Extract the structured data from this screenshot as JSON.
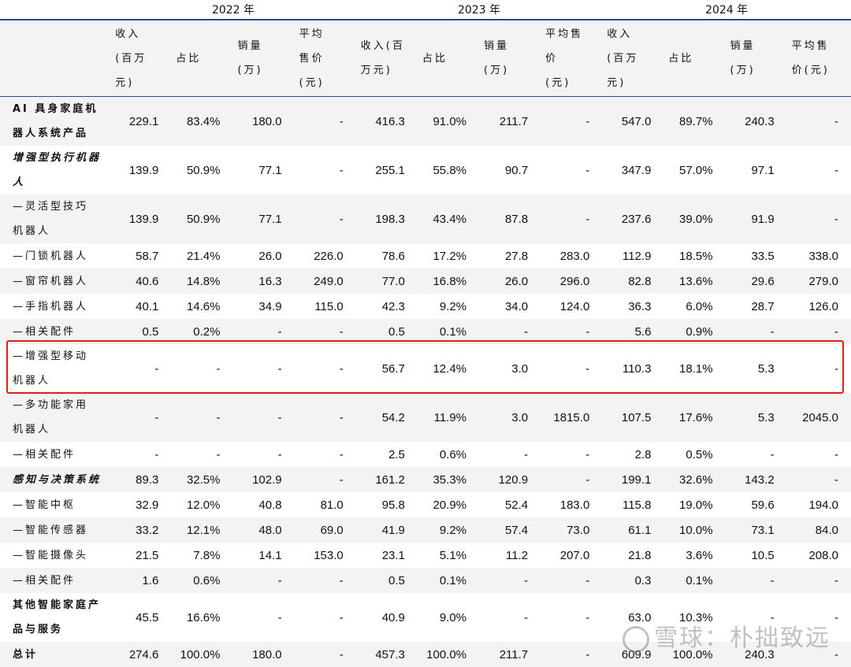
{
  "years": [
    "2022 年",
    "2023 年",
    "2024 年"
  ],
  "headers": {
    "h2022": [
      "收入\n(百万\n元)",
      "占比",
      "销量\n(万)",
      "平均\n售价\n(元)"
    ],
    "h2023": [
      "收入(百\n万元)",
      "占比",
      "销量\n(万)",
      "平均售\n价\n(元)"
    ],
    "h2024": [
      "收入\n(百万\n元)",
      "占比",
      "销量\n(万)",
      "平均售\n价(元)"
    ]
  },
  "rows": [
    {
      "label": "AI 具身家庭机\n器人系统产品",
      "style": "bold",
      "v": [
        "229.1",
        "83.4%",
        "180.0",
        "-",
        "416.3",
        "91.0%",
        "211.7",
        "-",
        "547.0",
        "89.7%",
        "240.3",
        "-"
      ]
    },
    {
      "label": "增强型执行机器\n人",
      "style": "bold-italic",
      "v": [
        "139.9",
        "50.9%",
        "77.1",
        "-",
        "255.1",
        "55.8%",
        "90.7",
        "-",
        "347.9",
        "57.0%",
        "97.1",
        "-"
      ]
    },
    {
      "label": "—灵活型技巧\n机器人",
      "style": "",
      "v": [
        "139.9",
        "50.9%",
        "77.1",
        "-",
        "198.3",
        "43.4%",
        "87.8",
        "-",
        "237.6",
        "39.0%",
        "91.9",
        "-"
      ]
    },
    {
      "label": "—门锁机器人",
      "style": "",
      "v": [
        "58.7",
        "21.4%",
        "26.0",
        "226.0",
        "78.6",
        "17.2%",
        "27.8",
        "283.0",
        "112.9",
        "18.5%",
        "33.5",
        "338.0"
      ]
    },
    {
      "label": "—窗帘机器人",
      "style": "",
      "v": [
        "40.6",
        "14.8%",
        "16.3",
        "249.0",
        "77.0",
        "16.8%",
        "26.0",
        "296.0",
        "82.8",
        "13.6%",
        "29.6",
        "279.0"
      ]
    },
    {
      "label": "—手指机器人",
      "style": "",
      "v": [
        "40.1",
        "14.6%",
        "34.9",
        "115.0",
        "42.3",
        "9.2%",
        "34.0",
        "124.0",
        "36.3",
        "6.0%",
        "28.7",
        "126.0"
      ]
    },
    {
      "label": "—相关配件",
      "style": "",
      "v": [
        "0.5",
        "0.2%",
        "-",
        "-",
        "0.5",
        "0.1%",
        "-",
        "-",
        "5.6",
        "0.9%",
        "-",
        "-"
      ]
    },
    {
      "label": "—增强型移动\n机器人",
      "style": "",
      "v": [
        "-",
        "-",
        "-",
        "-",
        "56.7",
        "12.4%",
        "3.0",
        "-",
        "110.3",
        "18.1%",
        "5.3",
        "-"
      ]
    },
    {
      "label": "—多功能家用\n机器人",
      "style": "",
      "v": [
        "-",
        "-",
        "-",
        "-",
        "54.2",
        "11.9%",
        "3.0",
        "1815.0",
        "107.5",
        "17.6%",
        "5.3",
        "2045.0"
      ]
    },
    {
      "label": "—相关配件",
      "style": "",
      "v": [
        "-",
        "-",
        "-",
        "-",
        "2.5",
        "0.6%",
        "-",
        "-",
        "2.8",
        "0.5%",
        "-",
        "-"
      ]
    },
    {
      "label": "感知与决策系统",
      "style": "bold-italic",
      "v": [
        "89.3",
        "32.5%",
        "102.9",
        "-",
        "161.2",
        "35.3%",
        "120.9",
        "-",
        "199.1",
        "32.6%",
        "143.2",
        "-"
      ]
    },
    {
      "label": "—智能中枢",
      "style": "",
      "v": [
        "32.9",
        "12.0%",
        "40.8",
        "81.0",
        "95.8",
        "20.9%",
        "52.4",
        "183.0",
        "115.8",
        "19.0%",
        "59.6",
        "194.0"
      ]
    },
    {
      "label": "—智能传感器",
      "style": "",
      "v": [
        "33.2",
        "12.1%",
        "48.0",
        "69.0",
        "41.9",
        "9.2%",
        "57.4",
        "73.0",
        "61.1",
        "10.0%",
        "73.1",
        "84.0"
      ]
    },
    {
      "label": "—智能摄像头",
      "style": "",
      "v": [
        "21.5",
        "7.8%",
        "14.1",
        "153.0",
        "23.1",
        "5.1%",
        "11.2",
        "207.0",
        "21.8",
        "3.6%",
        "10.5",
        "208.0"
      ]
    },
    {
      "label": "—相关配件",
      "style": "",
      "v": [
        "1.6",
        "0.6%",
        "-",
        "-",
        "0.5",
        "0.1%",
        "-",
        "-",
        "0.3",
        "0.1%",
        "-",
        "-"
      ]
    },
    {
      "label": "其他智能家庭产\n品与服务",
      "style": "bold",
      "v": [
        "45.5",
        "16.6%",
        "-",
        "-",
        "40.9",
        "9.0%",
        "-",
        "-",
        "63.0",
        "10.3%",
        "-",
        "-"
      ]
    },
    {
      "label": "总计",
      "style": "bold",
      "v": [
        "274.6",
        "100.0%",
        "180.0",
        "-",
        "457.3",
        "100.0%",
        "211.7",
        "-",
        "609.9",
        "100.0%",
        "240.3",
        "-"
      ]
    }
  ],
  "watermark": "雪球：朴拙致远",
  "colors": {
    "header_rule": "#2a4a8c",
    "highlight": "#e0201a",
    "stripe": "#f3f3f3"
  }
}
